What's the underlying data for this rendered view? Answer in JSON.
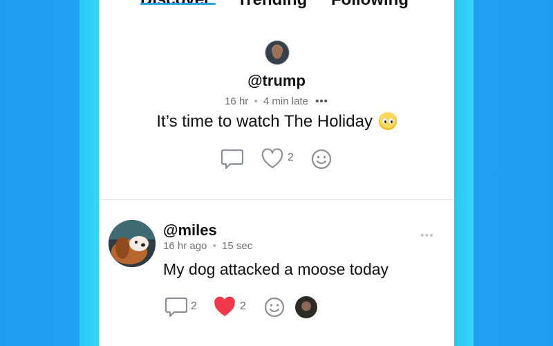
{
  "tabs": [
    {
      "label": "Discover",
      "active": true
    },
    {
      "label": "Trending",
      "active": false
    },
    {
      "label": "Following",
      "active": false
    }
  ],
  "featured_post": {
    "username": "@trump",
    "time": "16 hr",
    "separator": "•",
    "delay": "4 min late",
    "more": "•••",
    "text": "It’s time to watch The Holiday",
    "emoji": "pleading-face-emoji",
    "likes": "2"
  },
  "post": {
    "username": "@miles",
    "time": "16 hr ago",
    "separator": "•",
    "duration": "15 sec",
    "more": "•••",
    "text": "My dog attacked a moose today",
    "comments": "2",
    "likes": "2"
  },
  "colors": {
    "background": "#1f9df0",
    "accent_strip": "#37d5f8",
    "tab_underline": "#2aa0e6",
    "heart_filled": "#f0394a",
    "icon_gray": "#8a9096"
  }
}
